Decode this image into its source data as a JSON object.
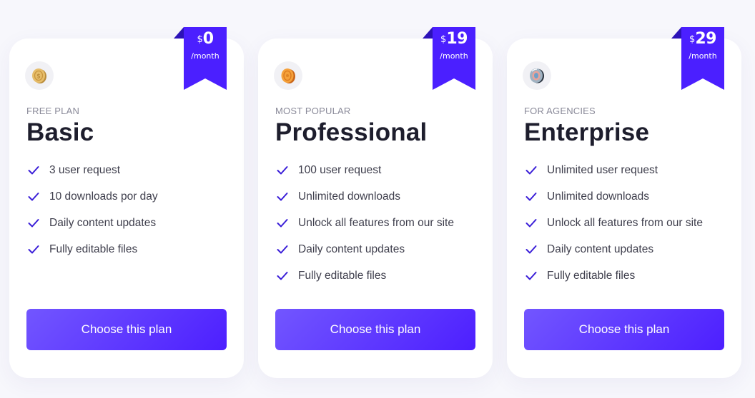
{
  "colors": {
    "accent": "#4d1fff",
    "accent_light": "#7256ff",
    "ribbon": "#4b1fff",
    "ribbon_fold": "#2c12b8",
    "check": "#3a1ed8",
    "title": "#1e1e2d",
    "tag": "#8a8a99",
    "background": "#f7f7fc"
  },
  "plans": [
    {
      "currency": "$",
      "price": "0",
      "period": "/month",
      "icon": "gold-coin-icon",
      "tag": "FREE PLAN",
      "name": "Basic",
      "features": [
        "3 user request",
        "10 downloads por day",
        "Daily content updates",
        "Fully editable files"
      ],
      "button_label": "Choose this plan"
    },
    {
      "currency": "$",
      "price": "19",
      "period": "/month",
      "icon": "orange-coin-icon",
      "tag": "MOST POPULAR",
      "name": "Professional",
      "features": [
        "100 user request",
        "Unlimited downloads",
        "Unlock all features from our site",
        "Daily content updates",
        "Fully editable files"
      ],
      "button_label": "Choose this plan"
    },
    {
      "currency": "$",
      "price": "29",
      "period": "/month",
      "icon": "premium-coin-icon",
      "tag": "FOR AGENCIES",
      "name": "Enterprise",
      "features": [
        "Unlimited user request",
        "Unlimited downloads",
        "Unlock all features from our site",
        "Daily content updates",
        "Fully editable files"
      ],
      "button_label": "Choose this plan"
    }
  ]
}
